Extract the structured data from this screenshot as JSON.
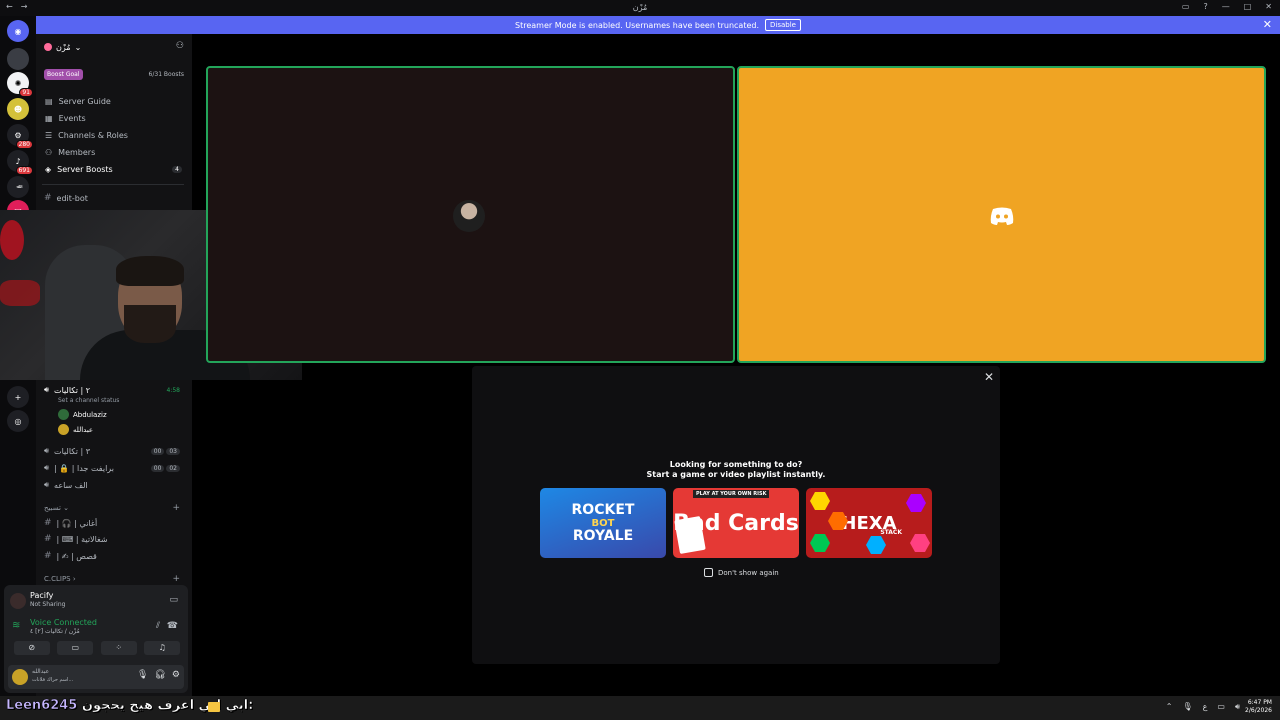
{
  "window": {
    "title": "مُزْن",
    "controls": [
      "□",
      "?",
      "—",
      "□",
      "✕"
    ]
  },
  "banner": {
    "text": "Streamer Mode is enabled. Usernames have been truncated.",
    "disable_label": "Disable",
    "close": "✕"
  },
  "rail": {
    "badges": [
      "91",
      "280",
      "691"
    ]
  },
  "server": {
    "name": "مُزْن",
    "boost_goal": "Boost Goal",
    "boost_count": "6/31 Boosts"
  },
  "menu": [
    {
      "label": "Server Guide",
      "icon": "guide-icon"
    },
    {
      "label": "Events",
      "icon": "calendar-icon"
    },
    {
      "label": "Channels & Roles",
      "icon": "list-icon"
    },
    {
      "label": "Members",
      "icon": "members-icon"
    },
    {
      "label": "Server Boosts",
      "icon": "boost-icon",
      "count": "4"
    }
  ],
  "channels": {
    "edit_bot": "edit-bot",
    "voice1": {
      "name": "٢ | تكاليات",
      "time": "4:58",
      "status": "Set a channel status"
    },
    "voice1_users": [
      "Abdulaziz",
      "عبدالله"
    ],
    "voice2": {
      "name": "٣ | تكاليات",
      "a": "00",
      "b": "03"
    },
    "voice3": {
      "name": "| 🔒 | برايفت جدا",
      "a": "00",
      "b": "02"
    },
    "voice4": {
      "name": "الف ساعه"
    },
    "category1": "تسبيح",
    "text1": "| 🎧 | أغاني",
    "text2": "| ⌨ | شغالاتية",
    "text3": "| ✍ | قصص",
    "category2": "C.CLIPS"
  },
  "userpanel": {
    "stream_name": "Pacify",
    "stream_status": "Not Sharing",
    "voice_title": "Voice Connected",
    "voice_sub": "مُزْن / تكاليات [٢] ٤",
    "me_name": "عبدالله",
    "me_status": "اسم حراك فلانات..."
  },
  "activity": {
    "line1": "Looking for something to do?",
    "line2": "Start a game or video playlist instantly.",
    "games": [
      {
        "name": "Rocket Bot Royale",
        "l1": "ROCKET",
        "l2": "BOT",
        "l3": "ROYALE"
      },
      {
        "name": "Bad Cards",
        "title": "Bad Cards",
        "tag": "PLAY AT YOUR OWN RISK"
      },
      {
        "name": "Hexa Stack",
        "title": "HEXA",
        "sub": "STACK"
      }
    ],
    "dont_show": "Don't show again"
  },
  "taskbar": {
    "caption_text": "ابي اني اعرف هيج يحجون: ",
    "caption_user": "Leen6245",
    "time": "6:47 PM",
    "date": "2/6/2026",
    "lang": "ع"
  }
}
